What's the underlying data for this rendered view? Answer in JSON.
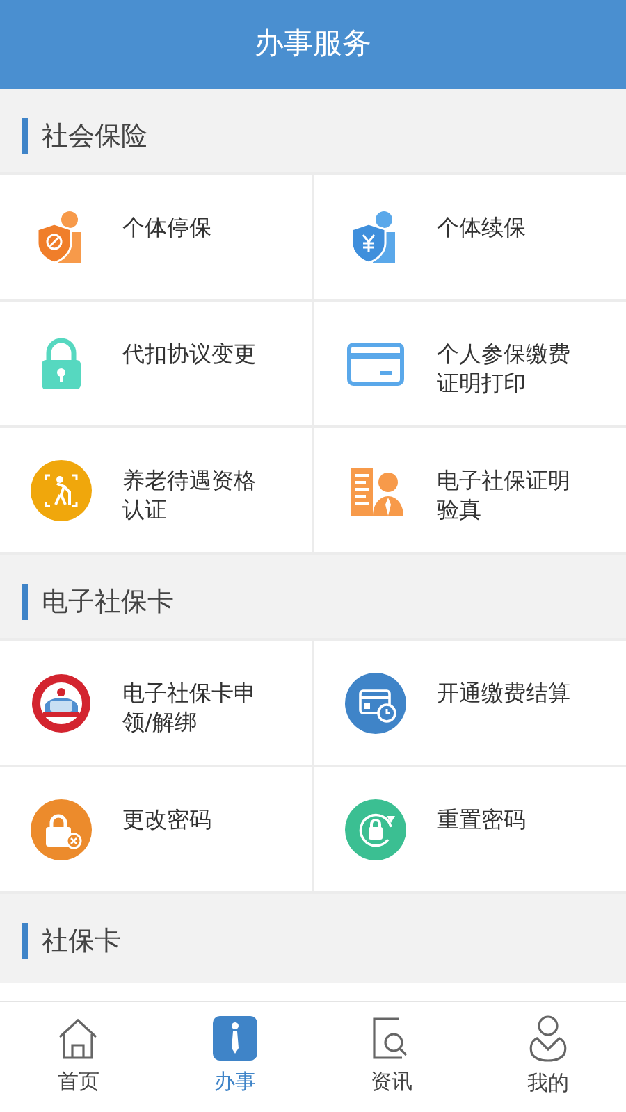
{
  "header": {
    "title": "办事服务"
  },
  "sections": [
    {
      "title": "社会保险",
      "items": [
        {
          "label": "个体停保"
        },
        {
          "label": "个体续保"
        },
        {
          "label": "代扣协议变更"
        },
        {
          "label": "个人参保缴费证明打印"
        },
        {
          "label": "养老待遇资格认证"
        },
        {
          "label": "电子社保证明验真"
        }
      ]
    },
    {
      "title": "电子社保卡",
      "items": [
        {
          "label": "电子社保卡申领/解绑"
        },
        {
          "label": "开通缴费结算"
        },
        {
          "label": "更改密码"
        },
        {
          "label": "重置密码"
        }
      ]
    },
    {
      "title": "社保卡"
    }
  ],
  "tab_bar": [
    {
      "label": "首页",
      "selected": false
    },
    {
      "label": "办事",
      "selected": true
    },
    {
      "label": "资讯",
      "selected": false
    },
    {
      "label": "我的",
      "selected": false
    }
  ]
}
